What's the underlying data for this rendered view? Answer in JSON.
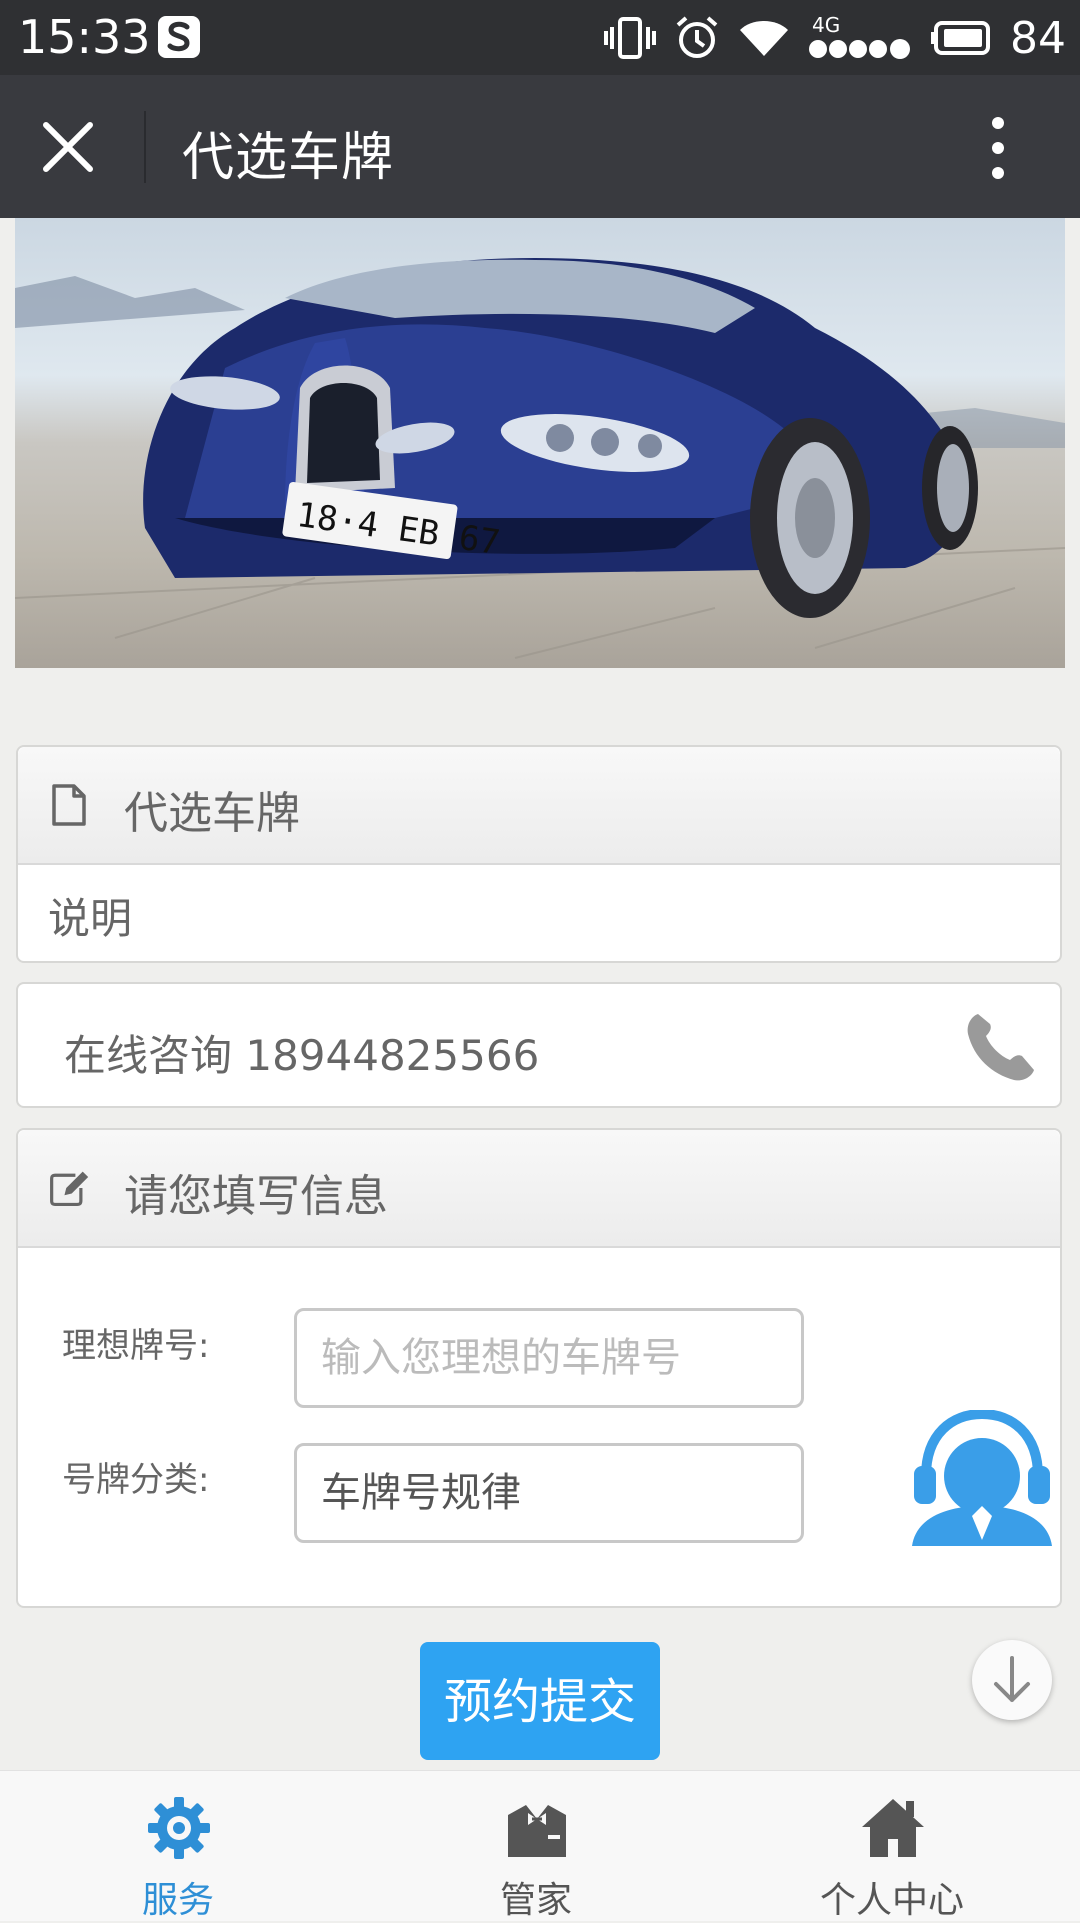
{
  "status_bar": {
    "time": "15:33",
    "network": "4G",
    "battery": "84",
    "icons": [
      "s-app-icon",
      "vibrate-icon",
      "alarm-icon",
      "wifi-icon",
      "signal-icon",
      "battery-icon"
    ]
  },
  "nav": {
    "title": "代选车牌",
    "close_icon": "close-icon",
    "more_icon": "more-vertical-icon"
  },
  "banner": {
    "plate_text": "18·4 EB 67"
  },
  "info_card": {
    "title": "代选车牌",
    "description": "说明",
    "icon": "document-icon"
  },
  "consult": {
    "text": "在线咨询 18944825566",
    "icon": "phone-icon"
  },
  "form": {
    "title": "请您填写信息",
    "icon": "edit-icon",
    "plate_label": "理想牌号:",
    "plate_placeholder": "输入您理想的车牌号",
    "category_label": "号牌分类:",
    "category_value": "车牌号规律",
    "support_icon": "customer-service-icon"
  },
  "submit_label": "预约提交",
  "tabs": [
    {
      "label": "服务",
      "icon": "gear-icon",
      "active": true
    },
    {
      "label": "管家",
      "icon": "butler-icon",
      "active": false
    },
    {
      "label": "个人中心",
      "icon": "home-icon",
      "active": false
    }
  ],
  "colors": {
    "accent": "#2ea3f2",
    "active_tab": "#2e8fd6",
    "nav_bg": "#393a3f",
    "status_bg": "#2f3033"
  }
}
